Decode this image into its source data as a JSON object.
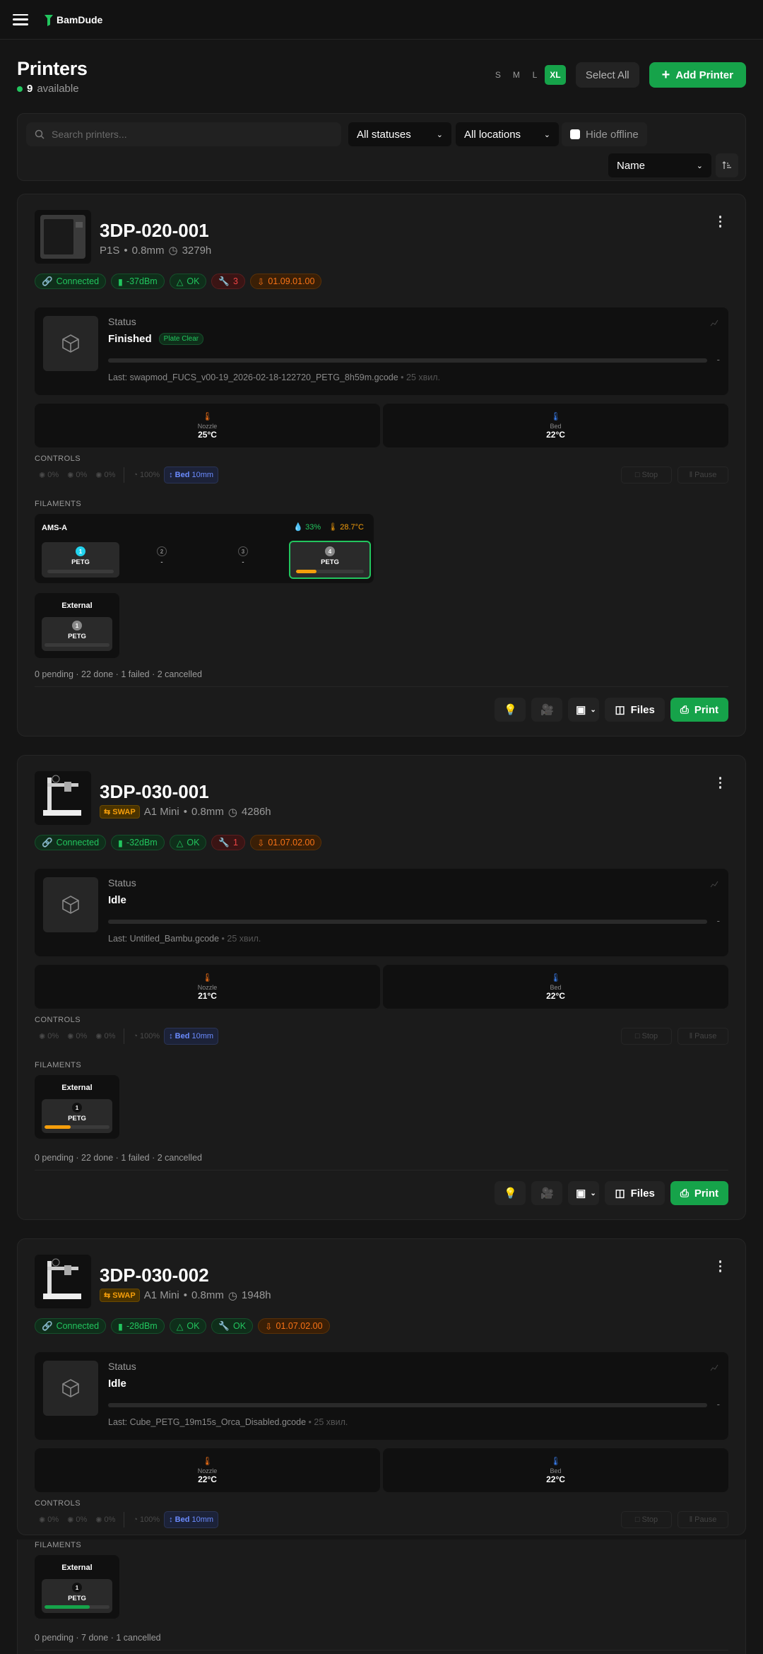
{
  "app": {
    "name": "BamDude"
  },
  "page": {
    "title": "Printers",
    "available_count": "9",
    "available_label": "available"
  },
  "toolbar": {
    "sizes": [
      "S",
      "M",
      "L",
      "XL"
    ],
    "select_all": "Select All",
    "add_printer": "Add Printer"
  },
  "filters": {
    "search_placeholder": "Search printers...",
    "status": "All statuses",
    "location": "All locations",
    "hide_offline": "Hide offline",
    "sort": "Name"
  },
  "labels": {
    "status": "Status",
    "nozzle": "Nozzle",
    "bed": "Bed",
    "controls": "CONTROLS",
    "filaments": "FILAMENTS",
    "external": "External",
    "files": "Files",
    "print": "Print",
    "stop": "Stop",
    "pause": "Pause",
    "plate_clear": "Plate Clear",
    "connected": "Connected",
    "ok": "OK",
    "swap": "SWAP"
  },
  "controls": {
    "fan1": "0%",
    "fan2": "0%",
    "fan3": "0%",
    "speed": "100%",
    "bed_move": "Bed",
    "bed_step": "10mm"
  },
  "printers": [
    {
      "name": "3DP-020-001",
      "model": "P1S",
      "nozzle": "0.8mm",
      "hours": "3279h",
      "signal": "-37dBm",
      "hms": "3",
      "firmware": "01.09.01.00",
      "state": "Finished",
      "last": "Last: swapmod_FUCS_v00-19_2026-02-18-122720_PETG_8h59m.gcode",
      "ago": "• 25 хвил.",
      "nozzle_temp": "25°C",
      "bed_temp": "22°C",
      "ams": {
        "name": "AMS-A",
        "humidity": "33%",
        "temp": "28.7°C",
        "slots": [
          {
            "num": "1",
            "material": "PETG",
            "fill": 0,
            "active": false,
            "color": "#22d3ee"
          },
          {
            "num": "2",
            "material": "-",
            "fill": 0,
            "active": false,
            "color": ""
          },
          {
            "num": "3",
            "material": "-",
            "fill": 0,
            "active": false,
            "color": ""
          },
          {
            "num": "4",
            "material": "PETG",
            "fill": 0.3,
            "active": true,
            "color": "#8a8a8a"
          }
        ]
      },
      "external": {
        "num": "1",
        "material": "PETG",
        "fill": 0
      },
      "queue": "0 pending · 22 done · 1 failed · 2 cancelled"
    },
    {
      "name": "3DP-030-001",
      "model": "A1 Mini",
      "nozzle": "0.8mm",
      "hours": "4286h",
      "signal": "-32dBm",
      "hms": "1",
      "firmware": "01.07.02.00",
      "state": "Idle",
      "last": "Last: Untitled_Bambu.gcode",
      "ago": "• 25 хвил.",
      "nozzle_temp": "21°C",
      "bed_temp": "22°C",
      "external": {
        "num": "1",
        "material": "PETG",
        "fill": 0.4
      },
      "queue": "0 pending · 22 done · 1 failed · 2 cancelled"
    },
    {
      "name": "3DP-030-002",
      "model": "A1 Mini",
      "nozzle": "0.8mm",
      "hours": "1948h",
      "signal": "-28dBm",
      "hms": "OK",
      "firmware": "01.07.02.00",
      "state": "Idle",
      "last": "Last: Cube_PETG_19m15s_Orca_Disabled.gcode",
      "ago": "• 25 хвил.",
      "nozzle_temp": "22°C",
      "bed_temp": "22°C",
      "external": {
        "num": "1",
        "material": "PETG",
        "fill": 0.7,
        "color": "#16a34a"
      },
      "queue": "0 pending · 7 done · 1 cancelled"
    }
  ]
}
